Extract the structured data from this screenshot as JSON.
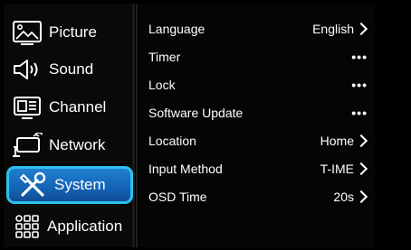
{
  "sidebar": {
    "items": [
      {
        "label": "Picture",
        "icon": "picture-icon"
      },
      {
        "label": "Sound",
        "icon": "speaker-icon"
      },
      {
        "label": "Channel",
        "icon": "channel-icon"
      },
      {
        "label": "Network",
        "icon": "network-icon"
      },
      {
        "label": "System",
        "icon": "tools-icon",
        "selected": true
      },
      {
        "label": "Application",
        "icon": "apps-grid-icon"
      }
    ]
  },
  "settings": {
    "rows": [
      {
        "label": "Language",
        "value": "English"
      },
      {
        "label": "Timer",
        "value": "•••"
      },
      {
        "label": "Lock",
        "value": "•••"
      },
      {
        "label": "Software Update",
        "value": "•••"
      },
      {
        "label": "Location",
        "value": "Home"
      },
      {
        "label": "Input Method",
        "value": "T-IME"
      },
      {
        "label": "OSD Time",
        "value": "20s"
      }
    ]
  },
  "colors": {
    "selected_fill": "#1565b8",
    "selected_border": "#2ec0ee",
    "text": "#ffffff",
    "background": "#000000"
  }
}
